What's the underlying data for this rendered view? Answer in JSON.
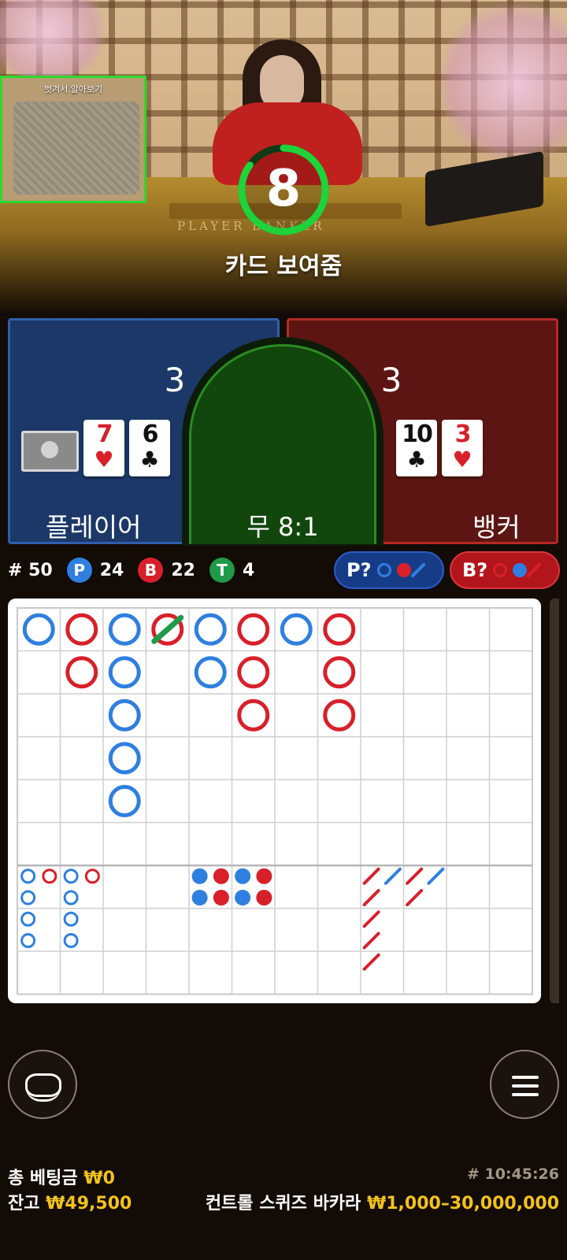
{
  "video": {
    "pip_title": "벗겨서 알아보기",
    "table_text": "PLAYER  BANKER"
  },
  "timer": {
    "value": "8",
    "progress": 0.85
  },
  "status_text": "카드 보여줌",
  "player": {
    "label": "플레이어",
    "score": "3",
    "cards": [
      {
        "rank": "7",
        "suit": "♥",
        "color": "red"
      },
      {
        "rank": "6",
        "suit": "♣",
        "color": "black"
      }
    ]
  },
  "banker": {
    "label": "뱅커",
    "score": "3",
    "cards": [
      {
        "rank": "10",
        "suit": "♣",
        "color": "black"
      },
      {
        "rank": "3",
        "suit": "♥",
        "color": "red"
      }
    ]
  },
  "tie": {
    "label": "무 8:1"
  },
  "stats": {
    "round": "# 50",
    "player_badge": "P",
    "player_count": "24",
    "banker_badge": "B",
    "banker_count": "22",
    "tie_badge": "T",
    "tie_count": "4"
  },
  "predict": {
    "player_label": "P?",
    "banker_label": "B?"
  },
  "colors": {
    "player": "#2f7fe0",
    "banker": "#d8202a",
    "tie": "#1f9b48"
  },
  "bead_road": [
    [
      "P"
    ],
    [
      "B",
      "B"
    ],
    [
      "P",
      "P",
      "P",
      "P",
      "P"
    ],
    [
      "B-T"
    ],
    [
      "P",
      "P"
    ],
    [
      "B",
      "B",
      "B"
    ],
    [
      "P"
    ],
    [
      "B",
      "B",
      "B"
    ]
  ],
  "big_eye_road": [
    [
      "P",
      "P",
      "P",
      "P"
    ],
    [
      "B"
    ],
    [
      "P",
      "P",
      "P",
      "P"
    ],
    [
      "B"
    ]
  ],
  "small_road": [
    [
      "P",
      "P"
    ],
    [
      "B",
      "B"
    ],
    [
      "P",
      "P"
    ],
    [
      "B",
      "B"
    ]
  ],
  "cockroach_road": [
    [
      "B",
      "B",
      "B",
      "B",
      "B"
    ],
    [
      "P"
    ],
    [
      "B",
      "B"
    ],
    [
      "P"
    ]
  ],
  "bottom": {
    "total_bet_label": "총 베팅금",
    "total_bet_value": "₩0",
    "balance_label": "잔고",
    "balance_value": "₩49,500",
    "table_name": "컨트롤 스퀴즈 바카라",
    "limits": "₩1,000–30,000,000",
    "timestamp": "# 10:45:26"
  }
}
